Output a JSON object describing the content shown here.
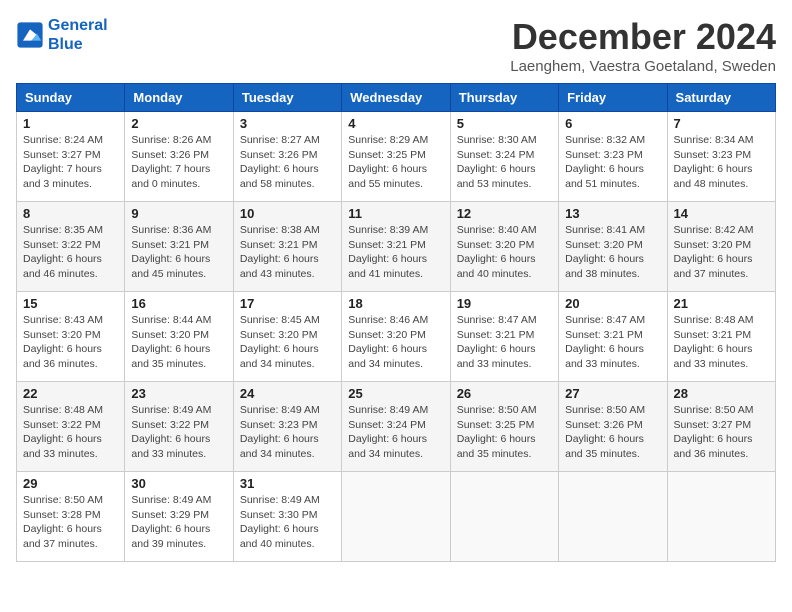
{
  "header": {
    "logo_line1": "General",
    "logo_line2": "Blue",
    "month_title": "December 2024",
    "location": "Laenghem, Vaestra Goetaland, Sweden"
  },
  "weekdays": [
    "Sunday",
    "Monday",
    "Tuesday",
    "Wednesday",
    "Thursday",
    "Friday",
    "Saturday"
  ],
  "weeks": [
    [
      {
        "day": "1",
        "sunrise": "Sunrise: 8:24 AM",
        "sunset": "Sunset: 3:27 PM",
        "daylight": "Daylight: 7 hours and 3 minutes."
      },
      {
        "day": "2",
        "sunrise": "Sunrise: 8:26 AM",
        "sunset": "Sunset: 3:26 PM",
        "daylight": "Daylight: 7 hours and 0 minutes."
      },
      {
        "day": "3",
        "sunrise": "Sunrise: 8:27 AM",
        "sunset": "Sunset: 3:26 PM",
        "daylight": "Daylight: 6 hours and 58 minutes."
      },
      {
        "day": "4",
        "sunrise": "Sunrise: 8:29 AM",
        "sunset": "Sunset: 3:25 PM",
        "daylight": "Daylight: 6 hours and 55 minutes."
      },
      {
        "day": "5",
        "sunrise": "Sunrise: 8:30 AM",
        "sunset": "Sunset: 3:24 PM",
        "daylight": "Daylight: 6 hours and 53 minutes."
      },
      {
        "day": "6",
        "sunrise": "Sunrise: 8:32 AM",
        "sunset": "Sunset: 3:23 PM",
        "daylight": "Daylight: 6 hours and 51 minutes."
      },
      {
        "day": "7",
        "sunrise": "Sunrise: 8:34 AM",
        "sunset": "Sunset: 3:23 PM",
        "daylight": "Daylight: 6 hours and 48 minutes."
      }
    ],
    [
      {
        "day": "8",
        "sunrise": "Sunrise: 8:35 AM",
        "sunset": "Sunset: 3:22 PM",
        "daylight": "Daylight: 6 hours and 46 minutes."
      },
      {
        "day": "9",
        "sunrise": "Sunrise: 8:36 AM",
        "sunset": "Sunset: 3:21 PM",
        "daylight": "Daylight: 6 hours and 45 minutes."
      },
      {
        "day": "10",
        "sunrise": "Sunrise: 8:38 AM",
        "sunset": "Sunset: 3:21 PM",
        "daylight": "Daylight: 6 hours and 43 minutes."
      },
      {
        "day": "11",
        "sunrise": "Sunrise: 8:39 AM",
        "sunset": "Sunset: 3:21 PM",
        "daylight": "Daylight: 6 hours and 41 minutes."
      },
      {
        "day": "12",
        "sunrise": "Sunrise: 8:40 AM",
        "sunset": "Sunset: 3:20 PM",
        "daylight": "Daylight: 6 hours and 40 minutes."
      },
      {
        "day": "13",
        "sunrise": "Sunrise: 8:41 AM",
        "sunset": "Sunset: 3:20 PM",
        "daylight": "Daylight: 6 hours and 38 minutes."
      },
      {
        "day": "14",
        "sunrise": "Sunrise: 8:42 AM",
        "sunset": "Sunset: 3:20 PM",
        "daylight": "Daylight: 6 hours and 37 minutes."
      }
    ],
    [
      {
        "day": "15",
        "sunrise": "Sunrise: 8:43 AM",
        "sunset": "Sunset: 3:20 PM",
        "daylight": "Daylight: 6 hours and 36 minutes."
      },
      {
        "day": "16",
        "sunrise": "Sunrise: 8:44 AM",
        "sunset": "Sunset: 3:20 PM",
        "daylight": "Daylight: 6 hours and 35 minutes."
      },
      {
        "day": "17",
        "sunrise": "Sunrise: 8:45 AM",
        "sunset": "Sunset: 3:20 PM",
        "daylight": "Daylight: 6 hours and 34 minutes."
      },
      {
        "day": "18",
        "sunrise": "Sunrise: 8:46 AM",
        "sunset": "Sunset: 3:20 PM",
        "daylight": "Daylight: 6 hours and 34 minutes."
      },
      {
        "day": "19",
        "sunrise": "Sunrise: 8:47 AM",
        "sunset": "Sunset: 3:21 PM",
        "daylight": "Daylight: 6 hours and 33 minutes."
      },
      {
        "day": "20",
        "sunrise": "Sunrise: 8:47 AM",
        "sunset": "Sunset: 3:21 PM",
        "daylight": "Daylight: 6 hours and 33 minutes."
      },
      {
        "day": "21",
        "sunrise": "Sunrise: 8:48 AM",
        "sunset": "Sunset: 3:21 PM",
        "daylight": "Daylight: 6 hours and 33 minutes."
      }
    ],
    [
      {
        "day": "22",
        "sunrise": "Sunrise: 8:48 AM",
        "sunset": "Sunset: 3:22 PM",
        "daylight": "Daylight: 6 hours and 33 minutes."
      },
      {
        "day": "23",
        "sunrise": "Sunrise: 8:49 AM",
        "sunset": "Sunset: 3:22 PM",
        "daylight": "Daylight: 6 hours and 33 minutes."
      },
      {
        "day": "24",
        "sunrise": "Sunrise: 8:49 AM",
        "sunset": "Sunset: 3:23 PM",
        "daylight": "Daylight: 6 hours and 34 minutes."
      },
      {
        "day": "25",
        "sunrise": "Sunrise: 8:49 AM",
        "sunset": "Sunset: 3:24 PM",
        "daylight": "Daylight: 6 hours and 34 minutes."
      },
      {
        "day": "26",
        "sunrise": "Sunrise: 8:50 AM",
        "sunset": "Sunset: 3:25 PM",
        "daylight": "Daylight: 6 hours and 35 minutes."
      },
      {
        "day": "27",
        "sunrise": "Sunrise: 8:50 AM",
        "sunset": "Sunset: 3:26 PM",
        "daylight": "Daylight: 6 hours and 35 minutes."
      },
      {
        "day": "28",
        "sunrise": "Sunrise: 8:50 AM",
        "sunset": "Sunset: 3:27 PM",
        "daylight": "Daylight: 6 hours and 36 minutes."
      }
    ],
    [
      {
        "day": "29",
        "sunrise": "Sunrise: 8:50 AM",
        "sunset": "Sunset: 3:28 PM",
        "daylight": "Daylight: 6 hours and 37 minutes."
      },
      {
        "day": "30",
        "sunrise": "Sunrise: 8:49 AM",
        "sunset": "Sunset: 3:29 PM",
        "daylight": "Daylight: 6 hours and 39 minutes."
      },
      {
        "day": "31",
        "sunrise": "Sunrise: 8:49 AM",
        "sunset": "Sunset: 3:30 PM",
        "daylight": "Daylight: 6 hours and 40 minutes."
      },
      null,
      null,
      null,
      null
    ]
  ]
}
